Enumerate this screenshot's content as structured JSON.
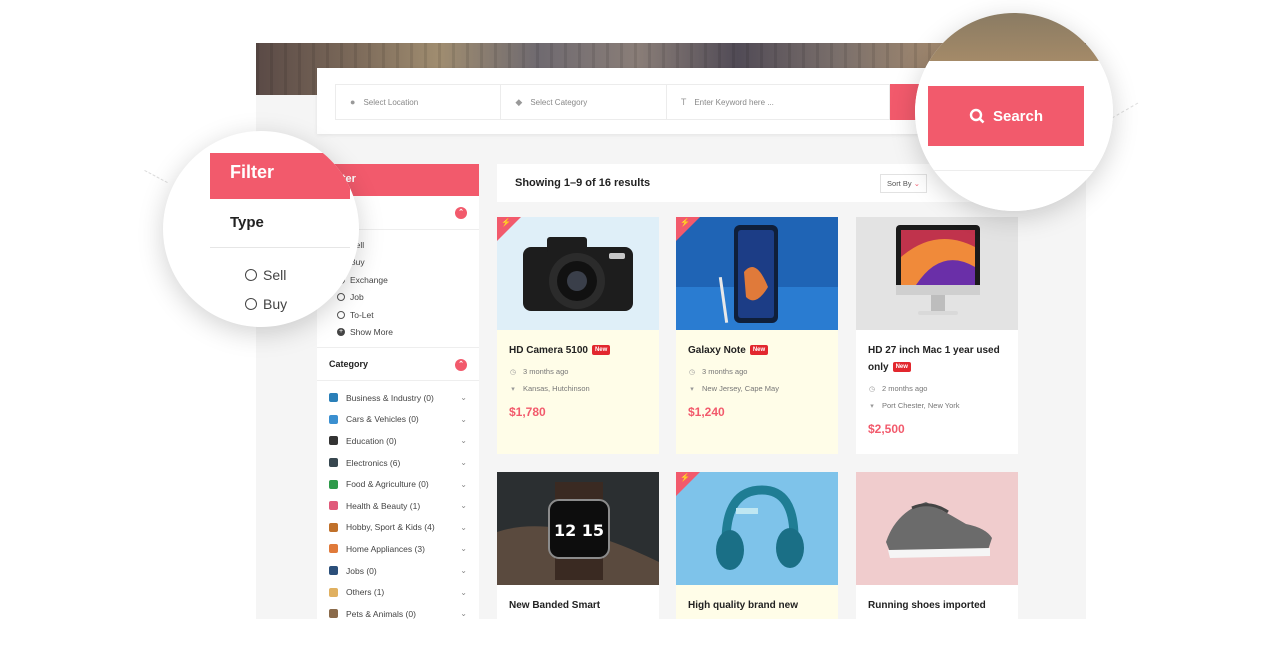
{
  "search": {
    "location_placeholder": "Select Location",
    "category_placeholder": "Select Category",
    "keyword_placeholder": "Enter Keyword here ...",
    "button_label": "Search"
  },
  "sidebar": {
    "filter_label": "Filter",
    "type_label": "Type",
    "type_options": [
      "Sell",
      "Buy",
      "Exchange",
      "Job",
      "To-Let"
    ],
    "show_more_label": "Show More",
    "category_label": "Category",
    "categories": [
      {
        "label": "Business & Industry (0)",
        "color": "#2a7fb8"
      },
      {
        "label": "Cars & Vehicles (0)",
        "color": "#3a8fd0"
      },
      {
        "label": "Education (0)",
        "color": "#333333"
      },
      {
        "label": "Electronics (6)",
        "color": "#37474f"
      },
      {
        "label": "Food & Agriculture (0)",
        "color": "#2e9a4a"
      },
      {
        "label": "Health & Beauty (1)",
        "color": "#e05a7a"
      },
      {
        "label": "Hobby, Sport & Kids (4)",
        "color": "#c0702a"
      },
      {
        "label": "Home Appliances (3)",
        "color": "#e07a3a"
      },
      {
        "label": "Jobs (0)",
        "color": "#2b4f7a"
      },
      {
        "label": "Others (1)",
        "color": "#e0b060"
      },
      {
        "label": "Pets & Animals (0)",
        "color": "#8a6a4a"
      }
    ]
  },
  "results": {
    "summary": "Showing 1–9 of 16 results",
    "sort_label": "Sort By"
  },
  "cards": [
    {
      "title": "HD Camera 5100",
      "badge": "New",
      "time": "3 months ago",
      "location": "Kansas, Hutchinson",
      "price": "$1,780",
      "featured": true,
      "icon": "camera"
    },
    {
      "title": "Galaxy Note",
      "badge": "New",
      "time": "3 months ago",
      "location": "New Jersey, Cape May",
      "price": "$1,240",
      "featured": true,
      "icon": "phone"
    },
    {
      "title": "HD 27 inch Mac 1 year used only",
      "badge": "New",
      "time": "2 months ago",
      "location": "Port Chester, New York",
      "price": "$2,500",
      "featured": false,
      "icon": "monitor"
    },
    {
      "title": "New Banded Smart",
      "featured": false,
      "icon": "watch"
    },
    {
      "title": "High quality brand new",
      "featured": true,
      "icon": "headphones"
    },
    {
      "title": "Running shoes imported",
      "featured": false,
      "icon": "shoe"
    }
  ],
  "watch_time": "12 15",
  "colors": {
    "accent": "#f25a6c",
    "badge": "#e2272e",
    "featured_bg": "#fffde8"
  }
}
